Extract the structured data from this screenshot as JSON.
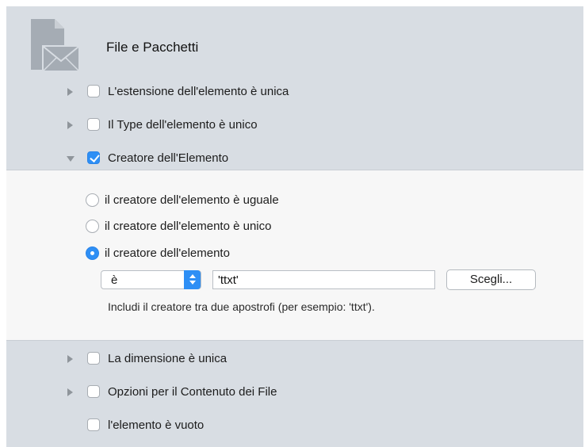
{
  "section": {
    "title": "File e Pacchetti",
    "icon": "document-envelope-icon"
  },
  "criteria_top": [
    {
      "label": "L'estensione dell'elemento è unica",
      "checked": false,
      "expanded": false
    },
    {
      "label": "Il Type dell'elemento è unico",
      "checked": false,
      "expanded": false
    },
    {
      "label": "Creatore dell'Elemento",
      "checked": true,
      "expanded": true
    }
  ],
  "creator_options": {
    "radios": [
      {
        "label": "il creatore dell'elemento è uguale",
        "selected": false
      },
      {
        "label": "il creatore dell'elemento è unico",
        "selected": false
      },
      {
        "label": "il creatore dell'elemento",
        "selected": true
      }
    ],
    "operator_value": "è",
    "creator_value": "'ttxt'",
    "choose_button": "Scegli...",
    "hint": "Includi il creatore tra due apostrofi (per esempio: 'ttxt')."
  },
  "criteria_bottom": [
    {
      "label": "La dimensione  è unica",
      "checked": false,
      "expanded": false
    },
    {
      "label": "Opzioni per il Contenuto dei File",
      "checked": false,
      "expanded": false
    },
    {
      "label": "l'elemento è vuoto",
      "checked": false
    }
  ],
  "colors": {
    "panel_bg": "#d8dde3",
    "detail_bg": "#f7f7f7",
    "accent": "#2e8ff5"
  }
}
